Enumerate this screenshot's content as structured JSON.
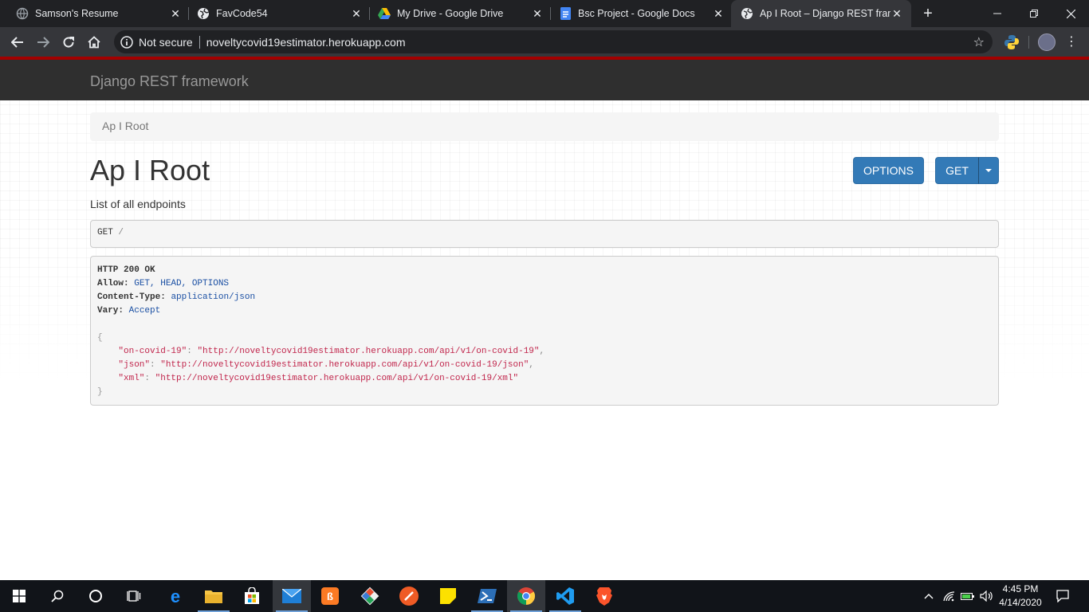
{
  "browser": {
    "tabs": [
      {
        "title": "Samson's Resume",
        "icon": "globe-icon"
      },
      {
        "title": "FavCode54",
        "icon": "globe-icon"
      },
      {
        "title": "My Drive - Google Drive",
        "icon": "google-drive-icon"
      },
      {
        "title": "Bsc Project - Google Docs",
        "icon": "google-docs-icon"
      },
      {
        "title": "Ap I Root – Django REST frame",
        "icon": "globe-icon",
        "active": true
      }
    ],
    "security_label": "Not secure",
    "url": "noveltycovid19estimator.herokuapp.com"
  },
  "page": {
    "brand": "Django REST framework",
    "breadcrumb": "Ap I Root",
    "title": "Ap I Root",
    "description": "List of all endpoints",
    "buttons": {
      "options": "OPTIONS",
      "get": "GET"
    },
    "request": {
      "method": "GET",
      "path": "/"
    },
    "response": {
      "status": "HTTP 200 OK",
      "allow_label": "Allow:",
      "allow_value": "GET, HEAD, OPTIONS",
      "content_type_label": "Content-Type:",
      "content_type_value": "application/json",
      "vary_label": "Vary:",
      "vary_value": "Accept",
      "open_brace": "{",
      "close_brace": "}",
      "entries": [
        {
          "key": "\"on-covid-19\"",
          "value": "\"http://noveltycovid19estimator.herokuapp.com/api/v1/on-covid-19\"",
          "trail": ","
        },
        {
          "key": "\"json\"",
          "value": "\"http://noveltycovid19estimator.herokuapp.com/api/v1/on-covid-19/json\"",
          "trail": ","
        },
        {
          "key": "\"xml\"",
          "value": "\"http://noveltycovid19estimator.herokuapp.com/api/v1/on-covid-19/xml\"",
          "trail": ""
        }
      ]
    }
  },
  "taskbar": {
    "apps": [
      "start-icon",
      "search-icon",
      "cortana-icon",
      "task-view-icon",
      "edge-icon",
      "file-explorer-icon",
      "store-icon",
      "mail-icon",
      "xampp-icon",
      "git-icon",
      "postman-icon",
      "sticky-notes-icon",
      "powershell-icon",
      "chrome-icon",
      "vscode-icon",
      "brave-icon"
    ],
    "time": "4:45 PM",
    "date": "4/14/2020"
  },
  "colors": {
    "drf_red": "#a30000",
    "button_blue": "#337ab7",
    "json_string": "#c1264c",
    "meta_blue": "#1a4fa3"
  }
}
